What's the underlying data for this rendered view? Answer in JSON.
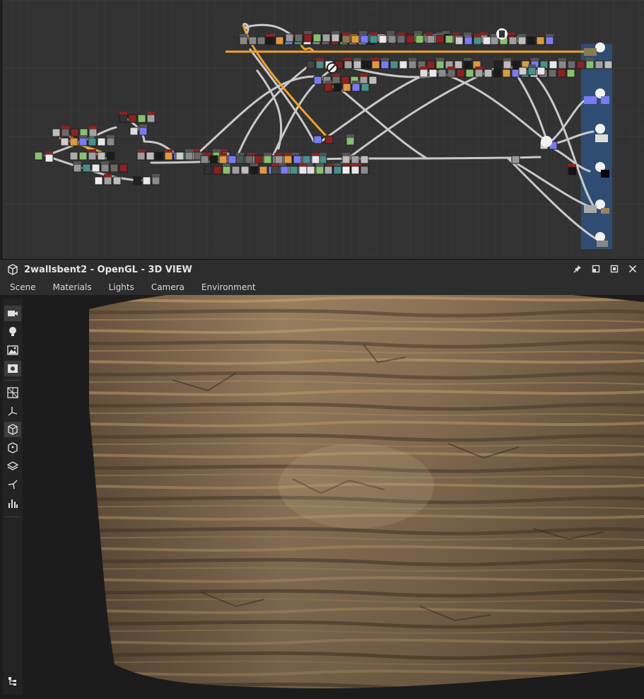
{
  "window": {
    "title": "2wallsbent2 - OpenGL - 3D VIEW"
  },
  "menu": [
    "Scene",
    "Materials",
    "Lights",
    "Camera",
    "Environment"
  ],
  "window_buttons": [
    "pin-icon",
    "restore-icon",
    "maximize-icon",
    "close-icon"
  ],
  "toolbar_icons": [
    "camera-icon",
    "light-bulb-icon",
    "environment-icon",
    "display-settings-icon",
    "grid-icon",
    "axis-icon",
    "cube-solid-icon",
    "cube-wire-icon",
    "layers-icon",
    "lightning-icon",
    "chart-icon",
    "tree-icon"
  ],
  "colors": {
    "graph_bg": "#323232",
    "link": "#c8c8c8",
    "link_highlight": "#f0a030",
    "output_panel": "#2f4f77"
  }
}
